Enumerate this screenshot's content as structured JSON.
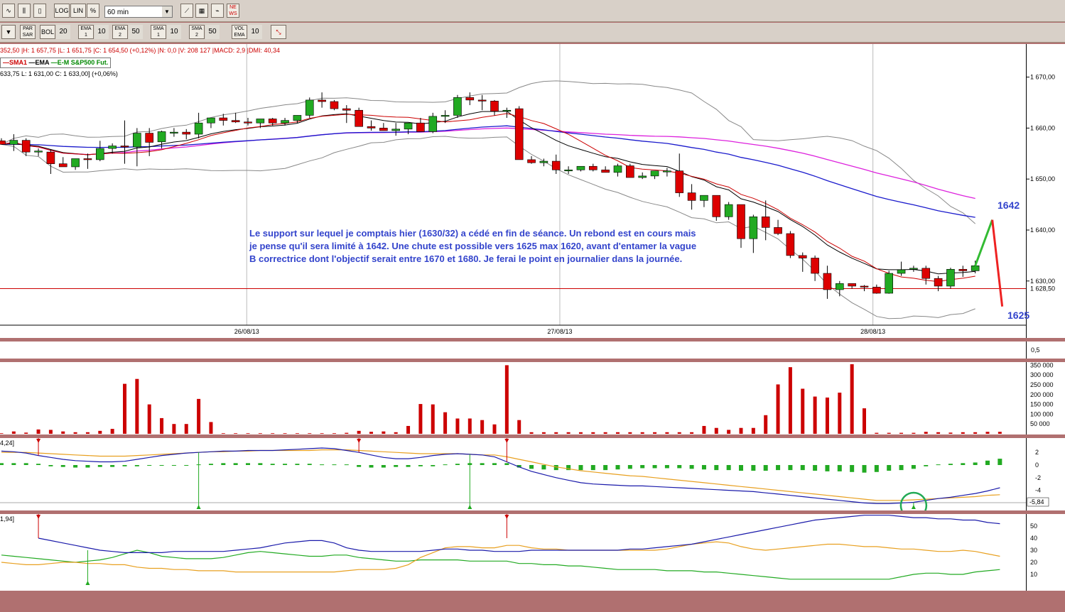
{
  "toolbar": {
    "row1": [
      "LOG",
      "LIN",
      "%"
    ],
    "timeframe": "60 min",
    "row2": [
      {
        "label": "PAR SAR",
        "value": ""
      },
      {
        "label": "BOL",
        "value": "20"
      },
      {
        "label": "EMA 1",
        "value": "10"
      },
      {
        "label": "EMA 2",
        "value": "50"
      },
      {
        "label": "SMA 1",
        "value": "10"
      },
      {
        "label": "SMA 2",
        "value": "50"
      },
      {
        "label": "VOL EMA",
        "value": "10"
      }
    ]
  },
  "info_line": "352,50 |H: 1 657,75 |L: 1 651,75 |C: 1 654,50 (+0,12%) |N: 0,0 |V: 208 127 |MACD: 2,9 |DMI: 40,34",
  "legend": {
    "sma1": "—SMA1",
    "ema": "—EMA",
    "instrument": "—E-M S&P500 Fut."
  },
  "ohlc_line": "633,75  L: 1 631,00  C: 1 633,00] (+0,06%)",
  "annotation": "Le support sur lequel je comptais hier (1630/32) a cédé en fin de séance. Un rebond est  en cours mais je pense qu'il sera limité à 1642. Une chute est possible vers 1625 max 1620, avant d'entamer la vague B correctrice dont l'objectif serait entre 1670 et 1680. Je ferai le point en journalier dans la journée.",
  "targets": {
    "up": "1642",
    "down": "1625"
  },
  "colors": {
    "up": "#22aa22",
    "down": "#dd0000",
    "bollinger": "#888888",
    "sma1": "#cc0000",
    "ema": "#000000",
    "blue_ma": "#1a1acc",
    "magenta_ma": "#dd22dd",
    "support_line": "#cc0000"
  },
  "chart_data": {
    "type": "candlestick",
    "dates": [
      "26/08/13",
      "27/08/13",
      "28/08/13"
    ],
    "price_ticks": [
      "1 670,00",
      "1 660,00",
      "1 650,00",
      "1 640,00",
      "1 630,00"
    ],
    "support_level": 1628.5,
    "support_label": "1 628,50",
    "candles": [
      [
        1657.5,
        1658,
        1656.8,
        1656.8
      ],
      [
        1656.8,
        1658.8,
        1655.5,
        1657.6
      ],
      [
        1657.6,
        1658,
        1654.5,
        1655.3
      ],
      [
        1655.3,
        1656,
        1654.5,
        1655.5
      ],
      [
        1655.3,
        1655.8,
        1651,
        1653
      ],
      [
        1653,
        1654.3,
        1652.5,
        1652.4
      ],
      [
        1652.4,
        1654,
        1651.8,
        1654
      ],
      [
        1654,
        1655,
        1652,
        1653.8
      ],
      [
        1653.8,
        1657.5,
        1653.5,
        1656
      ],
      [
        1656,
        1657,
        1655,
        1656.5
      ],
      [
        1656.5,
        1661.5,
        1653,
        1656.3
      ],
      [
        1656.3,
        1660,
        1652.5,
        1659
      ],
      [
        1659,
        1660,
        1654.5,
        1657.2
      ],
      [
        1657.3,
        1659.5,
        1656,
        1659.3
      ],
      [
        1659.2,
        1660,
        1658.3,
        1659.2
      ],
      [
        1659.2,
        1659.8,
        1657.8,
        1658.8
      ],
      [
        1658.8,
        1663,
        1658,
        1661
      ],
      [
        1661,
        1662,
        1660,
        1662
      ],
      [
        1662,
        1662.8,
        1660.5,
        1661.5
      ],
      [
        1661.5,
        1663,
        1661,
        1661.2
      ],
      [
        1661.2,
        1662,
        1660.5,
        1661
      ],
      [
        1661,
        1661.5,
        1660,
        1661.8
      ],
      [
        1661.8,
        1662,
        1660.5,
        1661
      ],
      [
        1661,
        1662,
        1660.5,
        1661.5
      ],
      [
        1661.5,
        1662.5,
        1661,
        1662.5
      ],
      [
        1662.5,
        1666,
        1662,
        1665.5
      ],
      [
        1665.5,
        1667,
        1664,
        1665.2
      ],
      [
        1665.2,
        1665.5,
        1663.5,
        1663.8
      ],
      [
        1663.8,
        1664.5,
        1661,
        1663.5
      ],
      [
        1663.5,
        1664,
        1660.5,
        1660.3
      ],
      [
        1660.3,
        1661.5,
        1659.5,
        1660
      ],
      [
        1660,
        1661,
        1659.5,
        1659.5
      ],
      [
        1659.5,
        1661,
        1658.5,
        1659.8
      ],
      [
        1659.8,
        1661,
        1658.8,
        1661
      ],
      [
        1661,
        1662,
        1659.5,
        1659.3
      ],
      [
        1659.3,
        1663,
        1659,
        1662.3
      ],
      [
        1662.3,
        1663.5,
        1661,
        1662.5
      ],
      [
        1662.5,
        1666.5,
        1662,
        1666
      ],
      [
        1666,
        1667,
        1664.5,
        1665.5
      ],
      [
        1665.5,
        1666.5,
        1663.5,
        1665.3
      ],
      [
        1665.3,
        1665.5,
        1662.5,
        1663.3
      ],
      [
        1663.3,
        1664,
        1662,
        1663.5
      ],
      [
        1663.8,
        1664.3,
        1653.8,
        1653.8
      ],
      [
        1653.8,
        1654.5,
        1653,
        1653.2
      ],
      [
        1653.2,
        1654,
        1652.5,
        1653.5
      ],
      [
        1653.5,
        1654.8,
        1651,
        1651.8
      ],
      [
        1651.8,
        1652.5,
        1651,
        1651.8
      ],
      [
        1651.8,
        1652.5,
        1651.5,
        1652.5
      ],
      [
        1652.5,
        1653,
        1651.5,
        1651.8
      ],
      [
        1651.8,
        1652.5,
        1651.3,
        1651.3
      ],
      [
        1651.3,
        1653,
        1650.5,
        1652.6
      ],
      [
        1652.6,
        1653,
        1650.3,
        1650.3
      ],
      [
        1650.3,
        1651.3,
        1650,
        1650.6
      ],
      [
        1650.6,
        1651.6,
        1650,
        1651.6
      ],
      [
        1651.6,
        1652.2,
        1650.5,
        1651.6
      ],
      [
        1651.6,
        1655,
        1646.5,
        1647.3
      ],
      [
        1647.3,
        1649,
        1644,
        1645.8
      ],
      [
        1645.8,
        1646.8,
        1644.5,
        1646.8
      ],
      [
        1646.8,
        1646.8,
        1641.8,
        1642.6
      ],
      [
        1642.6,
        1645.5,
        1642,
        1645
      ],
      [
        1645,
        1645,
        1636.5,
        1638.3
      ],
      [
        1638.3,
        1643,
        1635.5,
        1642.6
      ],
      [
        1642.6,
        1645.8,
        1638,
        1640.5
      ],
      [
        1640.5,
        1642,
        1639,
        1639.3
      ],
      [
        1639.3,
        1639.8,
        1634.5,
        1635
      ],
      [
        1635,
        1635.6,
        1631.8,
        1634.5
      ],
      [
        1634.5,
        1635,
        1630,
        1631.5
      ],
      [
        1631.5,
        1633,
        1626.5,
        1628.3
      ],
      [
        1628.3,
        1630,
        1627,
        1629.5
      ],
      [
        1629.5,
        1629.5,
        1628.5,
        1629
      ],
      [
        1629,
        1629.2,
        1628,
        1628.8
      ],
      [
        1628.8,
        1629.3,
        1627.5,
        1627.6
      ],
      [
        1627.6,
        1632,
        1627.5,
        1631.5
      ],
      [
        1631.5,
        1633.8,
        1631,
        1632.2
      ],
      [
        1632.3,
        1633,
        1631.8,
        1632.5
      ],
      [
        1632.5,
        1633,
        1629.3,
        1630.5
      ],
      [
        1630.5,
        1631,
        1628,
        1629
      ],
      [
        1629,
        1632.6,
        1628.5,
        1632.3
      ],
      [
        1632.3,
        1633,
        1630.8,
        1632
      ],
      [
        1632,
        1634,
        1631.5,
        1633
      ]
    ],
    "projection": [
      [
        1633,
        1642
      ],
      [
        1642,
        1625
      ]
    ],
    "volume": {
      "ticks": [
        "350 000",
        "300 000",
        "250 000",
        "200 000",
        "150 000",
        "100 000",
        "50 000"
      ],
      "values": [
        3000,
        12000,
        6000,
        22000,
        20000,
        12000,
        8000,
        8000,
        15000,
        25000,
        255000,
        280000,
        150000,
        80000,
        50000,
        50000,
        178000,
        60000,
        3000,
        3000,
        3000,
        3000,
        3000,
        3000,
        3000,
        3000,
        3000,
        3000,
        5000,
        15000,
        10000,
        12000,
        8000,
        40000,
        152000,
        150000,
        110000,
        78000,
        78000,
        70000,
        48000,
        350000,
        70000,
        8000,
        8000,
        8000,
        8000,
        8000,
        8000,
        8000,
        8000,
        8000,
        8000,
        8000,
        8000,
        8000,
        8000,
        40000,
        30000,
        20000,
        30000,
        30000,
        95000,
        252000,
        340000,
        230000,
        190000,
        185000,
        210000,
        355000,
        130000,
        5000,
        5000,
        5000,
        5000,
        10000,
        8000,
        6000,
        8000,
        8000,
        10000,
        10000
      ]
    },
    "macd": {
      "ticks": [
        "2",
        "0",
        "-2",
        "-4"
      ],
      "label": "-5,84",
      "header": "4,24]",
      "histogram": [
        0.3,
        0.3,
        0.3,
        0.2,
        -0.2,
        -0.3,
        -0.4,
        -0.4,
        -0.3,
        -0.3,
        -0.2,
        -0.2,
        -0.1,
        -0.1,
        -0.1,
        -0.1,
        0.1,
        0.2,
        0.3,
        0.3,
        0.3,
        0.3,
        0.2,
        0.2,
        0.2,
        0.2,
        0.1,
        0.1,
        0.1,
        -0.3,
        -0.4,
        -0.4,
        -0.3,
        -0.3,
        -0.2,
        -0.2,
        0.1,
        0.2,
        0.3,
        0.3,
        0.3,
        0.3,
        -0.4,
        -0.6,
        -0.7,
        -0.8,
        -0.8,
        -0.8,
        -0.8,
        -0.8,
        -0.7,
        -0.6,
        -0.5,
        -0.5,
        -0.5,
        -0.5,
        -0.6,
        -0.7,
        -0.8,
        -0.8,
        -0.9,
        -0.9,
        -0.9,
        -0.8,
        -0.8,
        -0.8,
        -0.9,
        -1.0,
        -1.0,
        -1.1,
        -1.2,
        -1.1,
        -0.9,
        -0.8,
        -0.6,
        -0.2,
        0.1,
        0.2,
        0.3,
        0.4,
        0.7,
        1.0
      ],
      "macd_line": [
        2.2,
        2.1,
        1.9,
        1.5,
        1.2,
        0.9,
        0.7,
        0.6,
        0.5,
        0.5,
        0.6,
        0.9,
        1.2,
        1.5,
        1.7,
        1.9,
        2.0,
        2.1,
        2.2,
        2.2,
        2.3,
        2.3,
        2.3,
        2.4,
        2.5,
        2.6,
        2.7,
        2.6,
        2.3,
        2.0,
        1.6,
        1.2,
        1.0,
        1.0,
        1.2,
        1.5,
        1.7,
        1.8,
        1.7,
        1.6,
        1.3,
        0.5,
        -0.3,
        -1.0,
        -1.5,
        -2.0,
        -2.4,
        -2.8,
        -3.0,
        -3.1,
        -3.2,
        -3.3,
        -3.3,
        -3.4,
        -3.5,
        -3.6,
        -3.7,
        -3.8,
        -3.9,
        -4.0,
        -4.1,
        -4.2,
        -4.4,
        -4.6,
        -4.8,
        -5.0,
        -5.2,
        -5.4,
        -5.6,
        -5.8,
        -6.0,
        -6.1,
        -6.1,
        -6.0,
        -5.9,
        -5.6,
        -5.3,
        -5.1,
        -4.8,
        -4.5,
        -4.1,
        -3.6
      ],
      "signal_line": [
        2.0,
        2.0,
        2.0,
        1.9,
        1.8,
        1.7,
        1.6,
        1.5,
        1.4,
        1.4,
        1.4,
        1.5,
        1.6,
        1.7,
        1.8,
        1.9,
        2.0,
        2.1,
        2.1,
        2.2,
        2.2,
        2.3,
        2.3,
        2.3,
        2.3,
        2.3,
        2.4,
        2.4,
        2.4,
        2.3,
        2.2,
        2.1,
        2.0,
        1.9,
        1.8,
        1.8,
        1.8,
        1.8,
        1.7,
        1.6,
        1.6,
        1.3,
        0.9,
        0.5,
        0.1,
        -0.3,
        -0.6,
        -0.9,
        -1.1,
        -1.3,
        -1.5,
        -1.7,
        -1.8,
        -2.0,
        -2.2,
        -2.4,
        -2.6,
        -2.8,
        -3.0,
        -3.2,
        -3.4,
        -3.6,
        -3.8,
        -4.0,
        -4.2,
        -4.4,
        -4.6,
        -4.8,
        -5.0,
        -5.2,
        -5.4,
        -5.6,
        -5.6,
        -5.6,
        -5.5,
        -5.4,
        -5.3,
        -5.2,
        -5.1,
        -5.0,
        -4.8,
        -4.7
      ]
    },
    "dmi": {
      "ticks": [
        "50",
        "40",
        "30",
        "20",
        "10"
      ],
      "header": "1,94]",
      "adx": [
        null,
        null,
        null,
        40,
        38,
        36,
        34,
        32,
        30,
        29,
        28,
        28,
        28,
        28,
        29,
        29,
        29,
        29,
        29,
        30,
        31,
        32,
        34,
        36,
        37,
        38,
        38,
        36,
        32,
        30,
        29,
        29,
        29,
        29,
        29,
        30,
        31,
        31,
        30,
        30,
        29,
        29,
        29,
        30,
        30,
        30,
        30,
        30,
        30,
        30,
        30,
        31,
        31,
        32,
        33,
        34,
        35,
        37,
        39,
        41,
        43,
        45,
        47,
        49,
        51,
        53,
        55,
        56,
        57,
        58,
        59,
        59,
        59,
        58,
        57,
        57,
        56,
        56,
        55,
        55,
        53,
        52
      ],
      "di_plus": [
        20,
        19,
        18,
        18,
        19,
        20,
        20,
        19,
        19,
        18,
        18,
        16,
        15,
        15,
        14,
        14,
        13,
        13,
        13,
        12,
        12,
        12,
        12,
        12,
        12,
        12,
        12,
        12,
        13,
        14,
        14,
        14,
        15,
        18,
        24,
        28,
        32,
        33,
        33,
        32,
        32,
        34,
        34,
        32,
        31,
        31,
        30,
        30,
        30,
        30,
        30,
        30,
        30,
        30,
        31,
        33,
        35,
        36,
        37,
        36,
        33,
        31,
        30,
        31,
        32,
        33,
        34,
        35,
        35,
        34,
        33,
        33,
        32,
        31,
        31,
        30,
        29,
        29,
        30,
        29,
        27,
        25
      ],
      "di_minus": [
        26,
        25,
        24,
        23,
        22,
        21,
        20,
        21,
        22,
        24,
        27,
        30,
        28,
        25,
        24,
        23,
        23,
        23,
        24,
        26,
        28,
        29,
        28,
        27,
        26,
        25,
        25,
        26,
        26,
        24,
        23,
        22,
        21,
        21,
        22,
        22,
        22,
        22,
        21,
        21,
        21,
        21,
        19,
        19,
        18,
        18,
        17,
        17,
        16,
        15,
        14,
        14,
        14,
        14,
        13,
        13,
        13,
        12,
        12,
        11,
        10,
        9,
        8,
        7,
        6,
        6,
        6,
        6,
        6,
        6,
        6,
        6,
        6,
        8,
        10,
        11,
        11,
        10,
        10,
        12,
        13,
        14
      ]
    },
    "osc_panel": {
      "tick": "0,5"
    }
  }
}
